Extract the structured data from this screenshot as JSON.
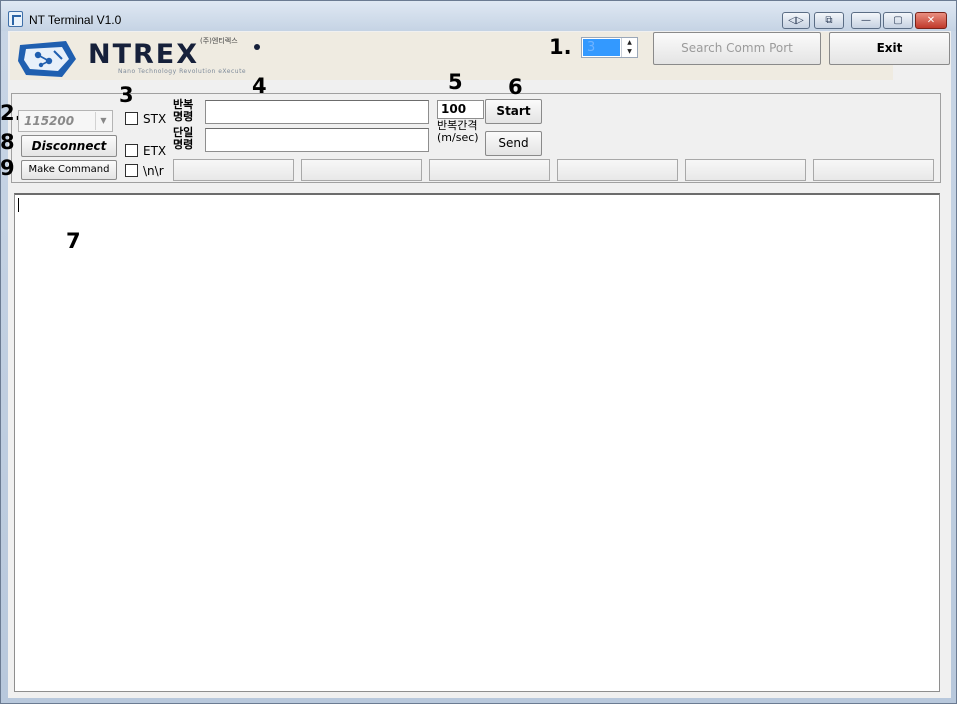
{
  "window": {
    "title": "NT Terminal V1.0",
    "buttons": {
      "restore_left": "◁▷",
      "restore_right": "⧉",
      "minimize": "—",
      "maximize": "▢",
      "close": "✕"
    }
  },
  "logo": {
    "brand": "NTREX",
    "korean": "(주)엔티렉스",
    "tagline": "Nano Technology Revolution eXecute"
  },
  "callouts": {
    "c1": "1.",
    "c2": "2.",
    "c3": "3",
    "c4": "4",
    "c5": "5",
    "c6": "6",
    "c7": "7",
    "c8": "8",
    "c9": "9"
  },
  "port": {
    "value": "3"
  },
  "buttons": {
    "search": "Search Comm Port",
    "exit": "Exit",
    "start": "Start",
    "send": "Send",
    "disconnect": "Disconnect",
    "make_command": "Make Command"
  },
  "baud": {
    "value": "115200"
  },
  "checkboxes": {
    "stx": "STX",
    "etx": "ETX",
    "newline": "\\n\\r"
  },
  "labels": {
    "repeat_cmd_line1": "반복",
    "repeat_cmd_line2": "명령",
    "single_cmd_line1": "단일",
    "single_cmd_line2": "명령",
    "interval": "반복간격",
    "interval_unit": "(m/sec)"
  },
  "interval": {
    "value": "100"
  },
  "colors": {
    "selection": "#3399ff",
    "close_button": "#c0392b",
    "banner": "#efebe1"
  }
}
